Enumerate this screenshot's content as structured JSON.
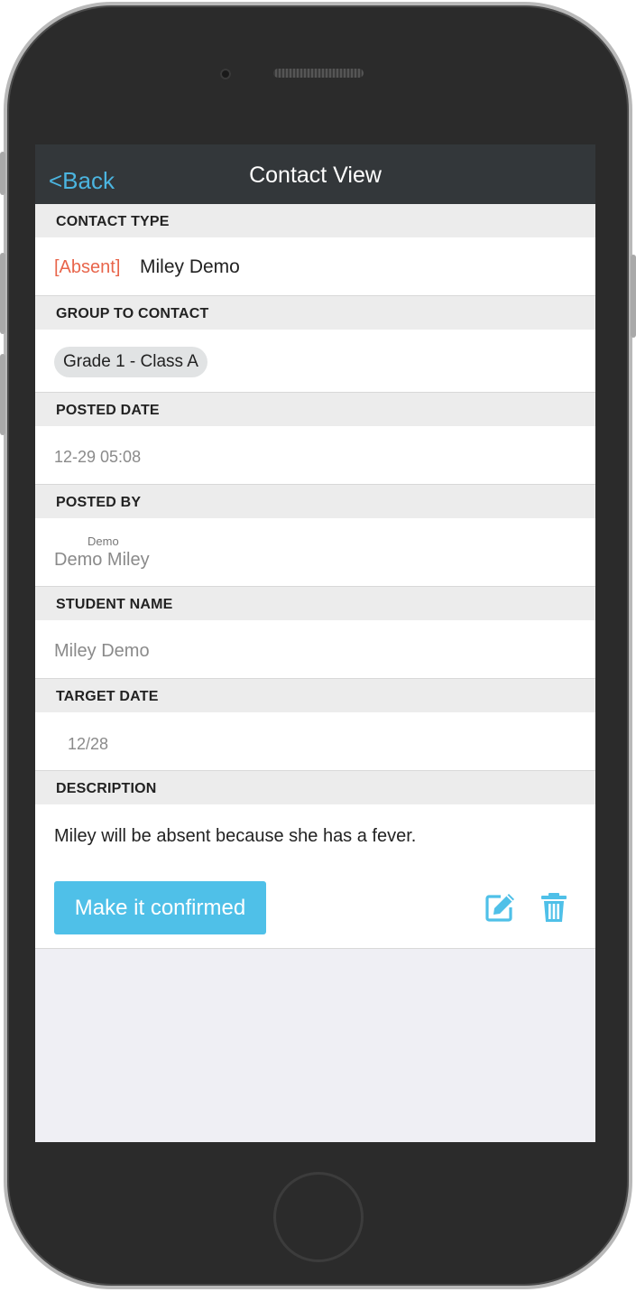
{
  "nav": {
    "back_label": "<Back",
    "title": "Contact View"
  },
  "sections": {
    "contact_type": {
      "header": "CONTACT TYPE",
      "tag": "[Absent]",
      "name": "Miley Demo"
    },
    "group": {
      "header": "GROUP TO CONTACT",
      "chip": "Grade 1 - Class A"
    },
    "posted_date": {
      "header": "POSTED DATE",
      "value": "12-29 05:08"
    },
    "posted_by": {
      "header": "POSTED BY",
      "small": "Demo",
      "name": "Demo Miley"
    },
    "student": {
      "header": "STUDENT NAME",
      "value": "Miley Demo"
    },
    "target_date": {
      "header": "TARGET DATE",
      "value": "12/28"
    },
    "description": {
      "header": "DESCRIPTION",
      "text": "Miley will be absent because she has a fever."
    }
  },
  "actions": {
    "confirm_label": "Make it confirmed",
    "edit_icon": "edit-icon",
    "trash_icon": "trash-icon"
  },
  "colors": {
    "accent": "#4fc0e8",
    "absent": "#e8654b",
    "navbar": "#33373a"
  }
}
